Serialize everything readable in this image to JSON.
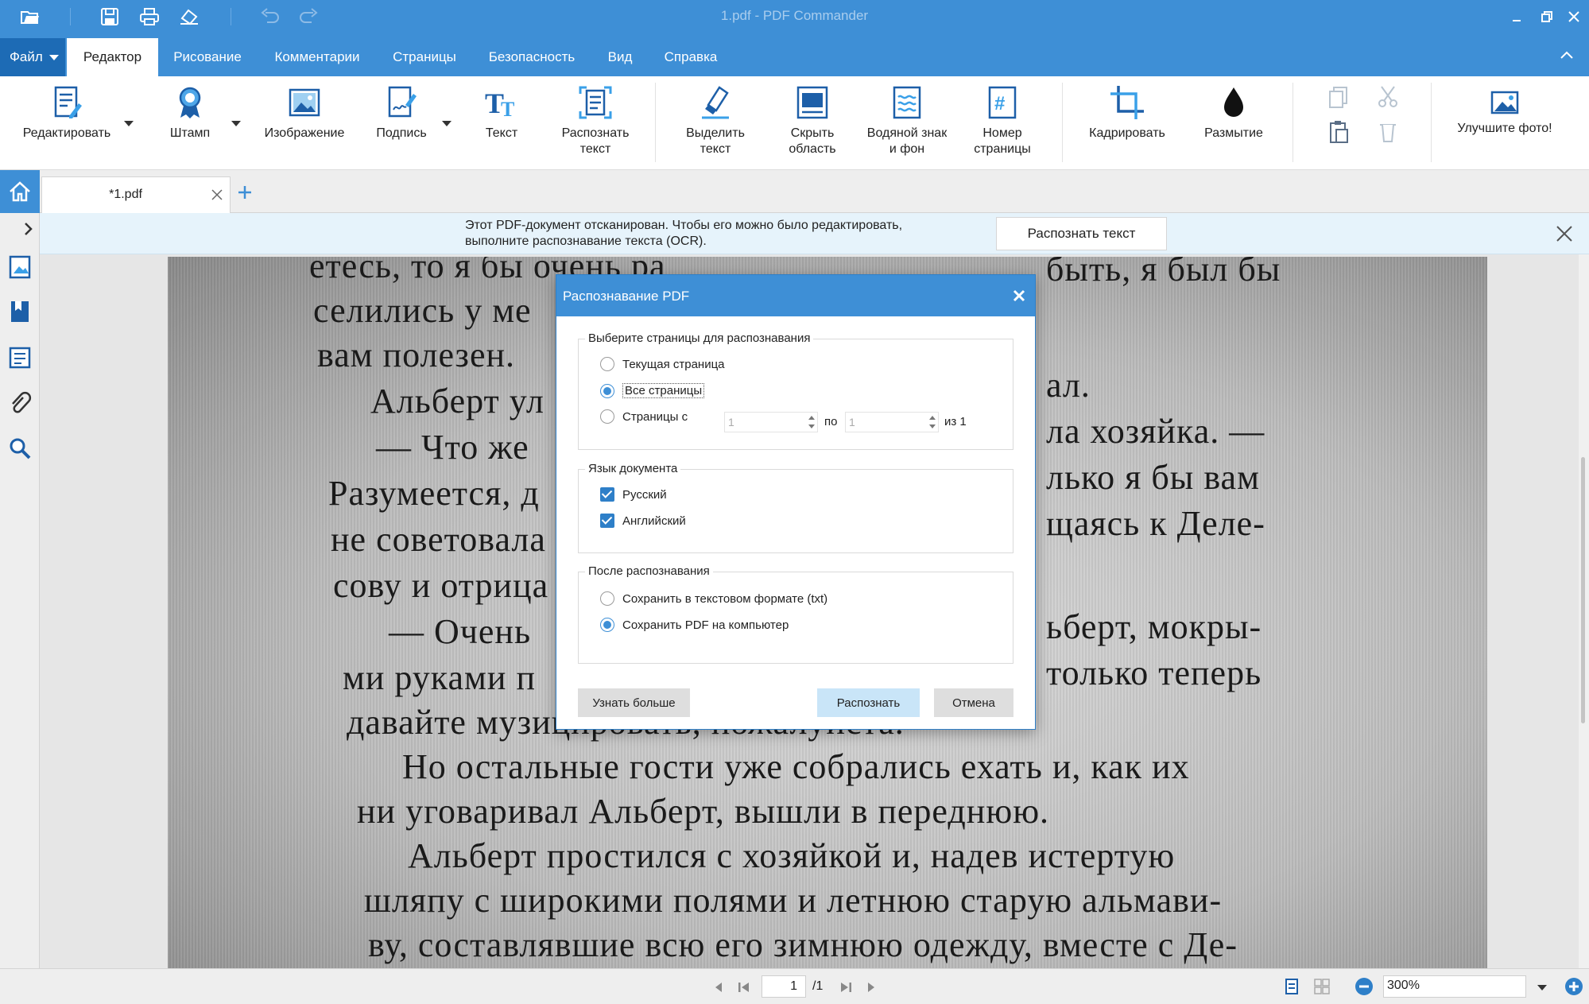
{
  "window": {
    "title": "1.pdf - PDF Commander"
  },
  "menu": {
    "file_label": "Файл",
    "tabs": [
      "Редактор",
      "Рисование",
      "Комментарии",
      "Страницы",
      "Безопасность",
      "Вид",
      "Справка"
    ],
    "active_tab": "Редактор"
  },
  "ribbon": {
    "edit": "Редактировать",
    "stamp": "Штамп",
    "image": "Изображение",
    "signature": "Подпись",
    "text": "Текст",
    "recognize": "Распознать\nтекст",
    "highlight": "Выделить\nтекст",
    "hide_area": "Скрыть\nобласть",
    "watermark": "Водяной знак\nи фон",
    "page_number": "Номер\nстраницы",
    "crop": "Кадрировать",
    "blur": "Размытие",
    "improve_photo": "Улучшите фото!"
  },
  "doc_tab": {
    "name": "*1.pdf"
  },
  "notice": {
    "line1": "Этот PDF-документ отсканирован. Чтобы его можно было редактировать,",
    "line2": "выполните распознавание текста (OCR).",
    "button": "Распознать текст"
  },
  "page_text": [
    "етесь, то я бы очень ра",
    "селились у ме",
    "вам полезен.",
    "Альберт ул",
    "— Что же",
    "Разумеется, д",
    "не советовала",
    "сову и отрица",
    "— Очень",
    "ми руками п",
    "давайте музицировать, пожалуйста.",
    "Но остальные гости уже собрались ехать и, как их",
    "ни уговаривал Альберт, вышли в переднюю.",
    "Альберт простился с хозяйкой и, надев истертую",
    "шляпу с широкими полями и летнюю старую альмави-",
    "ву, составлявшие всю его зимнюю одежду, вместе с Де-"
  ],
  "page_text_right": [
    "быть, я был бы",
    "ал.",
    "ла хозяйка. —",
    "лько я бы вам",
    "щаясь к Деле-",
    "ьберт, мокры-",
    "только теперь"
  ],
  "dialog": {
    "title": "Распознавание PDF",
    "pages_group": "Выберите страницы для распознавания",
    "opt_current": "Текущая страница",
    "opt_all": "Все страницы",
    "opt_range": "Страницы с",
    "range_from": "1",
    "range_to_label": "по",
    "range_to": "1",
    "range_of": "из 1",
    "lang_group": "Язык документа",
    "lang_ru": "Русский",
    "lang_en": "Английский",
    "after_group": "После распознавания",
    "after_txt": "Сохранить в текстовом формате (txt)",
    "after_pdf": "Сохранить PDF на компьютер",
    "btn_more": "Узнать больше",
    "btn_recognize": "Распознать",
    "btn_cancel": "Отмена",
    "selected_pages": "Все страницы",
    "selected_after": "Сохранить PDF на компьютер"
  },
  "status": {
    "current_page": "1",
    "total_pages": "/1",
    "zoom": "300%"
  },
  "colors": {
    "accent": "#3e8fd6",
    "file_tab": "#1d6bb5",
    "notice_bg": "#e6f3fb"
  }
}
